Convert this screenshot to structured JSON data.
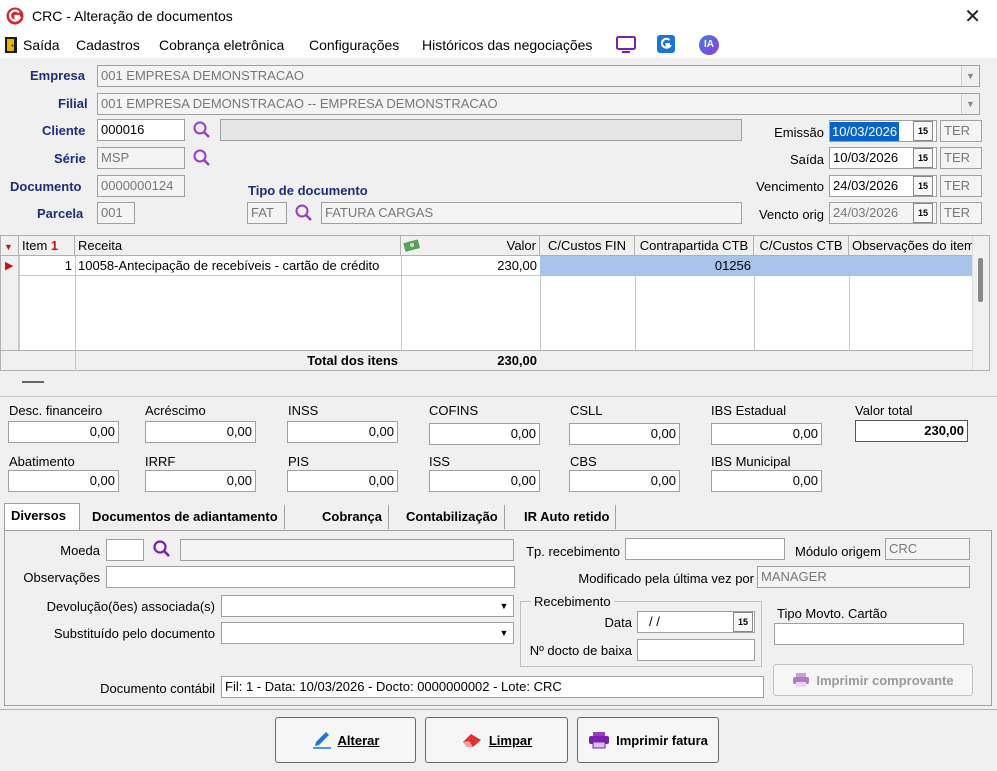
{
  "window": {
    "title": "CRC - Alteração de documentos",
    "close_glyph": "✕"
  },
  "menu": {
    "items": [
      "Saída",
      "Cadastros",
      "Cobrança eletrônica",
      "Configurações",
      "Históricos das negociações"
    ],
    "ia_label": "IA"
  },
  "header": {
    "empresa_label": "Empresa",
    "empresa_value": "001 EMPRESA DEMONSTRACAO",
    "filial_label": "Filial",
    "filial_value": "001 EMPRESA DEMONSTRACAO -- EMPRESA DEMONSTRACAO",
    "cliente_label": "Cliente",
    "cliente_value": "000016",
    "serie_label": "Série",
    "serie_value": "MSP",
    "documento_label": "Documento",
    "documento_value": "0000000124",
    "parcela_label": "Parcela",
    "parcela_value": "001",
    "tipo_doc_label": "Tipo de documento",
    "tipo_doc_code": "FAT",
    "tipo_doc_desc": "FATURA CARGAS",
    "emissao_label": "Emissão",
    "emissao_value": "10/03/2026",
    "emissao_day": "TER",
    "saida_label": "Saída",
    "saida_value": "10/03/2026",
    "saida_day": "TER",
    "vencimento_label": "Vencimento",
    "vencimento_value": "24/03/2026",
    "vencimento_day": "TER",
    "vencto_orig_label": "Vencto orig",
    "vencto_orig_value": "24/03/2026",
    "vencto_orig_day": "TER",
    "cal_glyph": "15"
  },
  "grid": {
    "columns": {
      "item": "Item",
      "item_badge": "1",
      "receita": "Receita",
      "valor": "Valor",
      "cc_fin": "C/Custos FIN",
      "contra_ctb": "Contrapartida CTB",
      "cc_ctb": "C/Custos CTB",
      "obs": "Observações do item"
    },
    "row": {
      "item": "1",
      "receita": "10058-Antecipação de recebíveis - cartão de crédito",
      "valor": "230,00",
      "contra_ctb": "01256"
    },
    "total_label": "Total dos itens",
    "total_value": "230,00"
  },
  "taxes": {
    "desc_fin_label": "Desc. financeiro",
    "desc_fin": "0,00",
    "acrescimo_label": "Acréscimo",
    "acrescimo": "0,00",
    "inss_label": "INSS",
    "inss": "0,00",
    "cofins_label": "COFINS",
    "cofins": "0,00",
    "csll_label": "CSLL",
    "csll": "0,00",
    "ibs_est_label": "IBS Estadual",
    "ibs_est": "0,00",
    "valor_total_label": "Valor total",
    "valor_total": "230,00",
    "abatimento_label": "Abatimento",
    "abatimento": "0,00",
    "irrf_label": "IRRF",
    "irrf": "0,00",
    "pis_label": "PIS",
    "pis": "0,00",
    "iss_label": "ISS",
    "iss": "0,00",
    "cbs_label": "CBS",
    "cbs": "0,00",
    "ibs_mun_label": "IBS Municipal",
    "ibs_mun": "0,00"
  },
  "tabs": [
    "Diversos",
    "Documentos de adiantamento",
    "Cobrança",
    "Contabilização",
    "IR Auto retido"
  ],
  "diversos": {
    "moeda_label": "Moeda",
    "observacoes_label": "Observações",
    "devolucao_label": "Devolução(ões) associada(s)",
    "substituido_label": "Substituído pelo documento",
    "tp_receb_label": "Tp. recebimento",
    "modulo_label": "Módulo origem",
    "modulo_value": "CRC",
    "modificado_label": "Modificado pela última vez por",
    "modificado_value": "MANAGER",
    "recebimento_group": "Recebimento",
    "data_label": "Data",
    "data_value": "/ /",
    "n_docto_label": "Nº docto de baixa",
    "tipo_movto_label": "Tipo Movto. Cartão",
    "imprimir_comprovante": "Imprimir comprovante",
    "doc_contabil_label": "Documento contábil",
    "doc_contabil_value": "Fil: 1 - Data: 10/03/2026 - Docto: 0000000002 - Lote: CRC"
  },
  "buttons": {
    "alterar": "Alterar",
    "limpar": "Limpar",
    "imprimir_fatura": "Imprimir fatura"
  }
}
